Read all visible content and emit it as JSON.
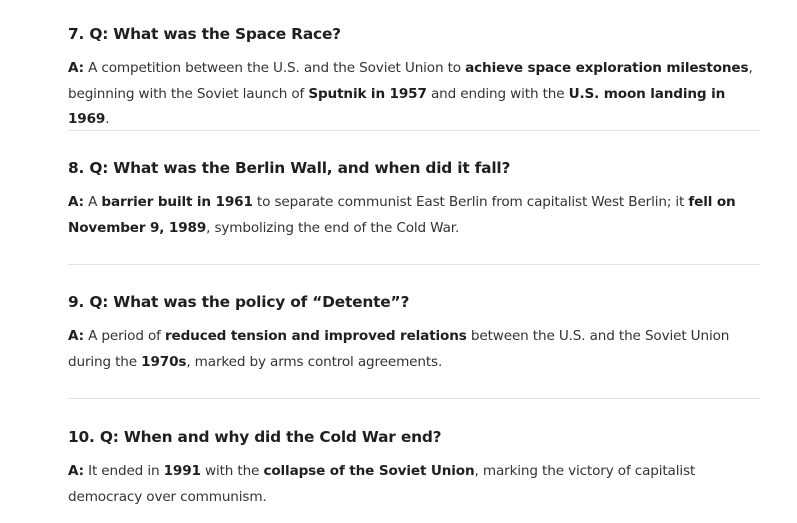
{
  "faqs": [
    {
      "question": "7. Q: What was the Space Race?",
      "answer_label": "A:",
      "answer_parts": [
        "A competition between the U.S. and the Soviet Union to ",
        "achieve space exploration milestones",
        ", beginning with the Soviet launch of ",
        "Sputnik in 1957",
        " and ending with the ",
        "U.S. moon landing in 1969",
        "."
      ]
    },
    {
      "question": "8. Q: What was the Berlin Wall, and when did it fall?",
      "answer_label": "A:",
      "answer_parts": [
        "A ",
        "barrier built in 1961",
        " to separate communist East Berlin from capitalist West Berlin; it ",
        "fell on November 9, 1989",
        ", symbolizing the end of the Cold War."
      ]
    },
    {
      "question": "9. Q: What was the policy of “Detente”?",
      "answer_label": "A:",
      "answer_parts": [
        "A period of ",
        "reduced tension and improved relations",
        " between the U.S. and the Soviet Union during the ",
        "1970s",
        ", marked by arms control agreements."
      ]
    },
    {
      "question": "10. Q: When and why did the Cold War end?",
      "answer_label": "A:",
      "answer_parts": [
        "It ended in ",
        "1991",
        " with the ",
        "collapse of the Soviet Union",
        ", marking the victory of capitalist democracy over communism."
      ]
    }
  ]
}
